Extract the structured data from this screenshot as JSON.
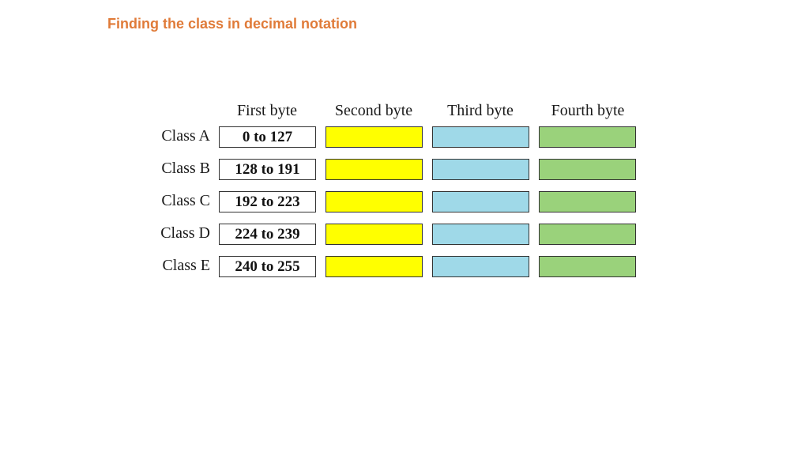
{
  "title": "Finding the class in decimal notation",
  "colors": {
    "title": "#e07b39",
    "first_byte": "#ffffff",
    "second_byte": "#ffff00",
    "third_byte": "#9fd9e8",
    "fourth_byte": "#9ad27b"
  },
  "columns": [
    "First byte",
    "Second byte",
    "Third byte",
    "Fourth byte"
  ],
  "rows": [
    {
      "label": "Class A",
      "first_byte_range": "0 to 127"
    },
    {
      "label": "Class B",
      "first_byte_range": "128 to 191"
    },
    {
      "label": "Class C",
      "first_byte_range": "192 to 223"
    },
    {
      "label": "Class D",
      "first_byte_range": "224 to 239"
    },
    {
      "label": "Class E",
      "first_byte_range": "240 to 255"
    }
  ]
}
